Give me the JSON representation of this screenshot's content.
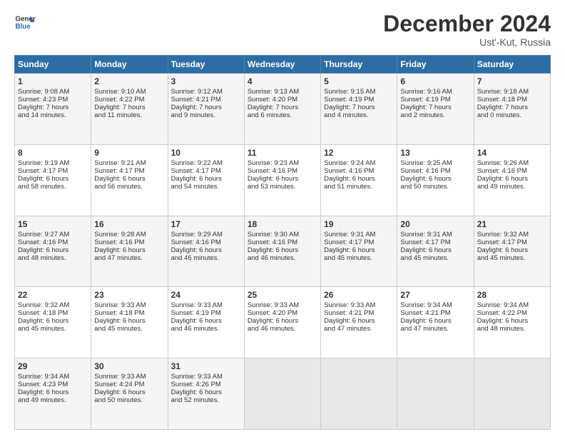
{
  "header": {
    "logo_line1": "General",
    "logo_line2": "Blue",
    "month": "December 2024",
    "location": "Ust'-Kut, Russia"
  },
  "weekdays": [
    "Sunday",
    "Monday",
    "Tuesday",
    "Wednesday",
    "Thursday",
    "Friday",
    "Saturday"
  ],
  "rows": [
    [
      {
        "day": "1",
        "lines": [
          "Sunrise: 9:08 AM",
          "Sunset: 4:23 PM",
          "Daylight: 7 hours",
          "and 14 minutes."
        ]
      },
      {
        "day": "2",
        "lines": [
          "Sunrise: 9:10 AM",
          "Sunset: 4:22 PM",
          "Daylight: 7 hours",
          "and 11 minutes."
        ]
      },
      {
        "day": "3",
        "lines": [
          "Sunrise: 9:12 AM",
          "Sunset: 4:21 PM",
          "Daylight: 7 hours",
          "and 9 minutes."
        ]
      },
      {
        "day": "4",
        "lines": [
          "Sunrise: 9:13 AM",
          "Sunset: 4:20 PM",
          "Daylight: 7 hours",
          "and 6 minutes."
        ]
      },
      {
        "day": "5",
        "lines": [
          "Sunrise: 9:15 AM",
          "Sunset: 4:19 PM",
          "Daylight: 7 hours",
          "and 4 minutes."
        ]
      },
      {
        "day": "6",
        "lines": [
          "Sunrise: 9:16 AM",
          "Sunset: 4:19 PM",
          "Daylight: 7 hours",
          "and 2 minutes."
        ]
      },
      {
        "day": "7",
        "lines": [
          "Sunrise: 9:18 AM",
          "Sunset: 4:18 PM",
          "Daylight: 7 hours",
          "and 0 minutes."
        ]
      }
    ],
    [
      {
        "day": "8",
        "lines": [
          "Sunrise: 9:19 AM",
          "Sunset: 4:17 PM",
          "Daylight: 6 hours",
          "and 58 minutes."
        ]
      },
      {
        "day": "9",
        "lines": [
          "Sunrise: 9:21 AM",
          "Sunset: 4:17 PM",
          "Daylight: 6 hours",
          "and 56 minutes."
        ]
      },
      {
        "day": "10",
        "lines": [
          "Sunrise: 9:22 AM",
          "Sunset: 4:17 PM",
          "Daylight: 6 hours",
          "and 54 minutes."
        ]
      },
      {
        "day": "11",
        "lines": [
          "Sunrise: 9:23 AM",
          "Sunset: 4:16 PM",
          "Daylight: 6 hours",
          "and 53 minutes."
        ]
      },
      {
        "day": "12",
        "lines": [
          "Sunrise: 9:24 AM",
          "Sunset: 4:16 PM",
          "Daylight: 6 hours",
          "and 51 minutes."
        ]
      },
      {
        "day": "13",
        "lines": [
          "Sunrise: 9:25 AM",
          "Sunset: 4:16 PM",
          "Daylight: 6 hours",
          "and 50 minutes."
        ]
      },
      {
        "day": "14",
        "lines": [
          "Sunrise: 9:26 AM",
          "Sunset: 4:16 PM",
          "Daylight: 6 hours",
          "and 49 minutes."
        ]
      }
    ],
    [
      {
        "day": "15",
        "lines": [
          "Sunrise: 9:27 AM",
          "Sunset: 4:16 PM",
          "Daylight: 6 hours",
          "and 48 minutes."
        ]
      },
      {
        "day": "16",
        "lines": [
          "Sunrise: 9:28 AM",
          "Sunset: 4:16 PM",
          "Daylight: 6 hours",
          "and 47 minutes."
        ]
      },
      {
        "day": "17",
        "lines": [
          "Sunrise: 9:29 AM",
          "Sunset: 4:16 PM",
          "Daylight: 6 hours",
          "and 46 minutes."
        ]
      },
      {
        "day": "18",
        "lines": [
          "Sunrise: 9:30 AM",
          "Sunset: 4:16 PM",
          "Daylight: 6 hours",
          "and 46 minutes."
        ]
      },
      {
        "day": "19",
        "lines": [
          "Sunrise: 9:31 AM",
          "Sunset: 4:17 PM",
          "Daylight: 6 hours",
          "and 45 minutes."
        ]
      },
      {
        "day": "20",
        "lines": [
          "Sunrise: 9:31 AM",
          "Sunset: 4:17 PM",
          "Daylight: 6 hours",
          "and 45 minutes."
        ]
      },
      {
        "day": "21",
        "lines": [
          "Sunrise: 9:32 AM",
          "Sunset: 4:17 PM",
          "Daylight: 6 hours",
          "and 45 minutes."
        ]
      }
    ],
    [
      {
        "day": "22",
        "lines": [
          "Sunrise: 9:32 AM",
          "Sunset: 4:18 PM",
          "Daylight: 6 hours",
          "and 45 minutes."
        ]
      },
      {
        "day": "23",
        "lines": [
          "Sunrise: 9:33 AM",
          "Sunset: 4:18 PM",
          "Daylight: 6 hours",
          "and 45 minutes."
        ]
      },
      {
        "day": "24",
        "lines": [
          "Sunrise: 9:33 AM",
          "Sunset: 4:19 PM",
          "Daylight: 6 hours",
          "and 46 minutes."
        ]
      },
      {
        "day": "25",
        "lines": [
          "Sunrise: 9:33 AM",
          "Sunset: 4:20 PM",
          "Daylight: 6 hours",
          "and 46 minutes."
        ]
      },
      {
        "day": "26",
        "lines": [
          "Sunrise: 9:33 AM",
          "Sunset: 4:21 PM",
          "Daylight: 6 hours",
          "and 47 minutes."
        ]
      },
      {
        "day": "27",
        "lines": [
          "Sunrise: 9:34 AM",
          "Sunset: 4:21 PM",
          "Daylight: 6 hours",
          "and 47 minutes."
        ]
      },
      {
        "day": "28",
        "lines": [
          "Sunrise: 9:34 AM",
          "Sunset: 4:22 PM",
          "Daylight: 6 hours",
          "and 48 minutes."
        ]
      }
    ],
    [
      {
        "day": "29",
        "lines": [
          "Sunrise: 9:34 AM",
          "Sunset: 4:23 PM",
          "Daylight: 6 hours",
          "and 49 minutes."
        ]
      },
      {
        "day": "30",
        "lines": [
          "Sunrise: 9:33 AM",
          "Sunset: 4:24 PM",
          "Daylight: 6 hours",
          "and 50 minutes."
        ]
      },
      {
        "day": "31",
        "lines": [
          "Sunrise: 9:33 AM",
          "Sunset: 4:26 PM",
          "Daylight: 6 hours",
          "and 52 minutes."
        ]
      },
      {
        "day": "",
        "lines": []
      },
      {
        "day": "",
        "lines": []
      },
      {
        "day": "",
        "lines": []
      },
      {
        "day": "",
        "lines": []
      }
    ]
  ]
}
